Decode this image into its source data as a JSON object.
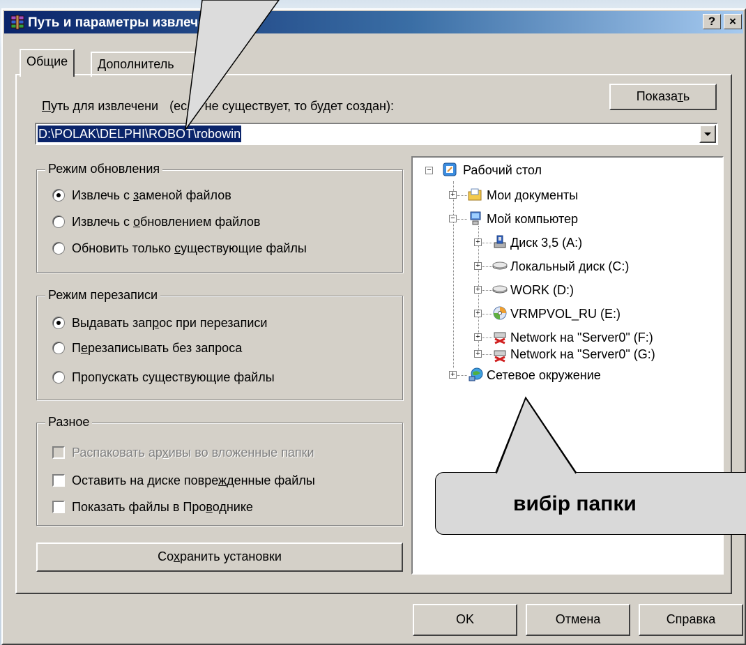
{
  "window": {
    "title": "Путь и параметры извлечения",
    "help_button": "?",
    "close_button": "×"
  },
  "tabs": [
    {
      "label": "Общие",
      "active": true
    },
    {
      "label": "Дополнитель",
      "active": false
    }
  ],
  "path": {
    "label_prefix": "",
    "label_u": "П",
    "label_rest": "уть для извлечени",
    "label_tail": "(если не существует, то бу",
    "label_u2": "д",
    "label_end": "ет создан):",
    "value": "D:\\POLAK\\DELPHI\\ROBOT\\robowin",
    "show_button_a": "Показа",
    "show_button_u": "т",
    "show_button_b": "ь"
  },
  "update_mode": {
    "title": "Режим обновления",
    "options": [
      {
        "a": "Извлечь с ",
        "u": "з",
        "b": "аменой файлов",
        "selected": true
      },
      {
        "a": "Извлечь с ",
        "u": "о",
        "b": "бновлением файлов",
        "selected": false
      },
      {
        "a": "Обновить только ",
        "u": "с",
        "b": "уществующие файлы",
        "selected": false
      }
    ]
  },
  "overwrite_mode": {
    "title": "Режим перезаписи",
    "options": [
      {
        "a": "Выдавать зап",
        "u": "р",
        "b": "ос при перезаписи",
        "selected": true
      },
      {
        "a": "П",
        "u": "е",
        "b": "резаписывать без запроса",
        "selected": false
      },
      {
        "a": "Пропускать существующие файлы",
        "u": "",
        "b": "",
        "selected": false
      }
    ]
  },
  "misc": {
    "title": "Разное",
    "options": [
      {
        "a": "Распаковать ар",
        "u": "х",
        "b": "ивы во вложенные папки",
        "checked": false,
        "disabled": true
      },
      {
        "a": "Оставить на диске повре",
        "u": "ж",
        "b": "денные файлы",
        "checked": false,
        "disabled": false
      },
      {
        "a": "Показать файлы в Про",
        "u": "в",
        "b": "однике",
        "checked": false,
        "disabled": false
      }
    ]
  },
  "save_button": {
    "a": "Со",
    "u": "х",
    "b": "ранить установки"
  },
  "tree": {
    "items": [
      {
        "label": "Рабочий стол",
        "icon": "desktop-icon",
        "expander": "−"
      },
      {
        "label": "Мои документы",
        "icon": "my-documents-icon",
        "expander": "+"
      },
      {
        "label": "Мой компьютер",
        "icon": "my-computer-icon",
        "expander": "−"
      },
      {
        "label": "Диск 3,5 (A:)",
        "icon": "floppy-icon",
        "expander": "+"
      },
      {
        "label": "Локальный диск (C:)",
        "icon": "hard-drive-icon",
        "expander": "+"
      },
      {
        "label": "WORK (D:)",
        "icon": "hard-drive-icon",
        "expander": "+"
      },
      {
        "label": "VRMPVOL_RU (E:)",
        "icon": "cd-drive-icon",
        "expander": "+"
      },
      {
        "label": "Network на \"Server0\" (F:)",
        "icon": "network-drive-icon",
        "expander": "+"
      },
      {
        "label": "Network на \"Server0\" (G:)",
        "icon": "network-drive-icon",
        "expander": "+"
      },
      {
        "label": "Сетевое окружение",
        "icon": "network-places-icon",
        "expander": "+"
      }
    ]
  },
  "buttons": {
    "ok": "OK",
    "cancel": "Отмена",
    "help": "Справка"
  },
  "callout": {
    "text": "вибір папки"
  }
}
